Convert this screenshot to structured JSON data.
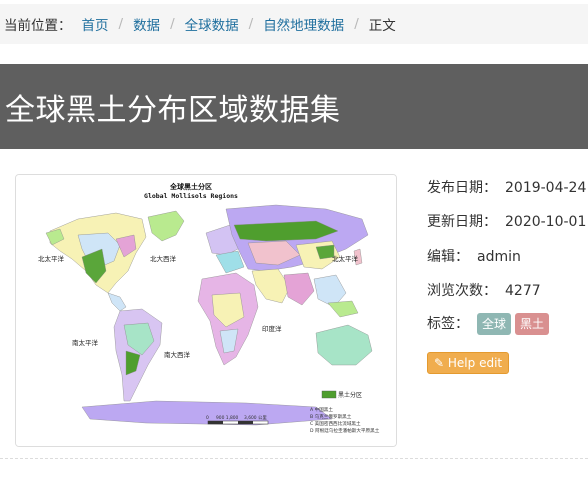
{
  "breadcrumb": {
    "prefix": "当前位置：",
    "items": [
      "首页",
      "数据",
      "全球数据",
      "自然地理数据"
    ],
    "separator": "/",
    "current": "正文"
  },
  "title": "全球黑土分布区域数据集",
  "map": {
    "title": "全球黑土分区",
    "subtitle": "Global Mollisols Regions",
    "labels": {
      "north_pacific_left": "北太平洋",
      "north_atlantic": "北大西洋",
      "north_pacific_right": "北太平洋",
      "indian_ocean": "印度洋",
      "south_pacific": "南太平洋",
      "south_atlantic": "南大西洋"
    },
    "legend_title": "黑土分区",
    "legend_items": [
      "A 中国黑土",
      "B 乌克兰俄罗斯黑土",
      "C 美国密西西比流域黑土",
      "D 阿根廷乌拉圭潘帕斯大平原黑土"
    ],
    "scale_labels": [
      "0",
      "900 1,800",
      "3,600 公里"
    ]
  },
  "meta": {
    "publish_label": "发布日期：",
    "publish_date": "2019-04-24",
    "update_label": "更新日期：",
    "update_date": "2020-10-01",
    "editor_label": "编辑：",
    "editor": "admin",
    "views_label": "浏览次数：",
    "views": "4277",
    "tags_label": "标签：",
    "tags": [
      "全球",
      "黑土"
    ],
    "help_label": "Help edit",
    "colors": {
      "tag1": "#8fb7b3",
      "tag2": "#d99090",
      "help": "#f0ad4e"
    }
  }
}
